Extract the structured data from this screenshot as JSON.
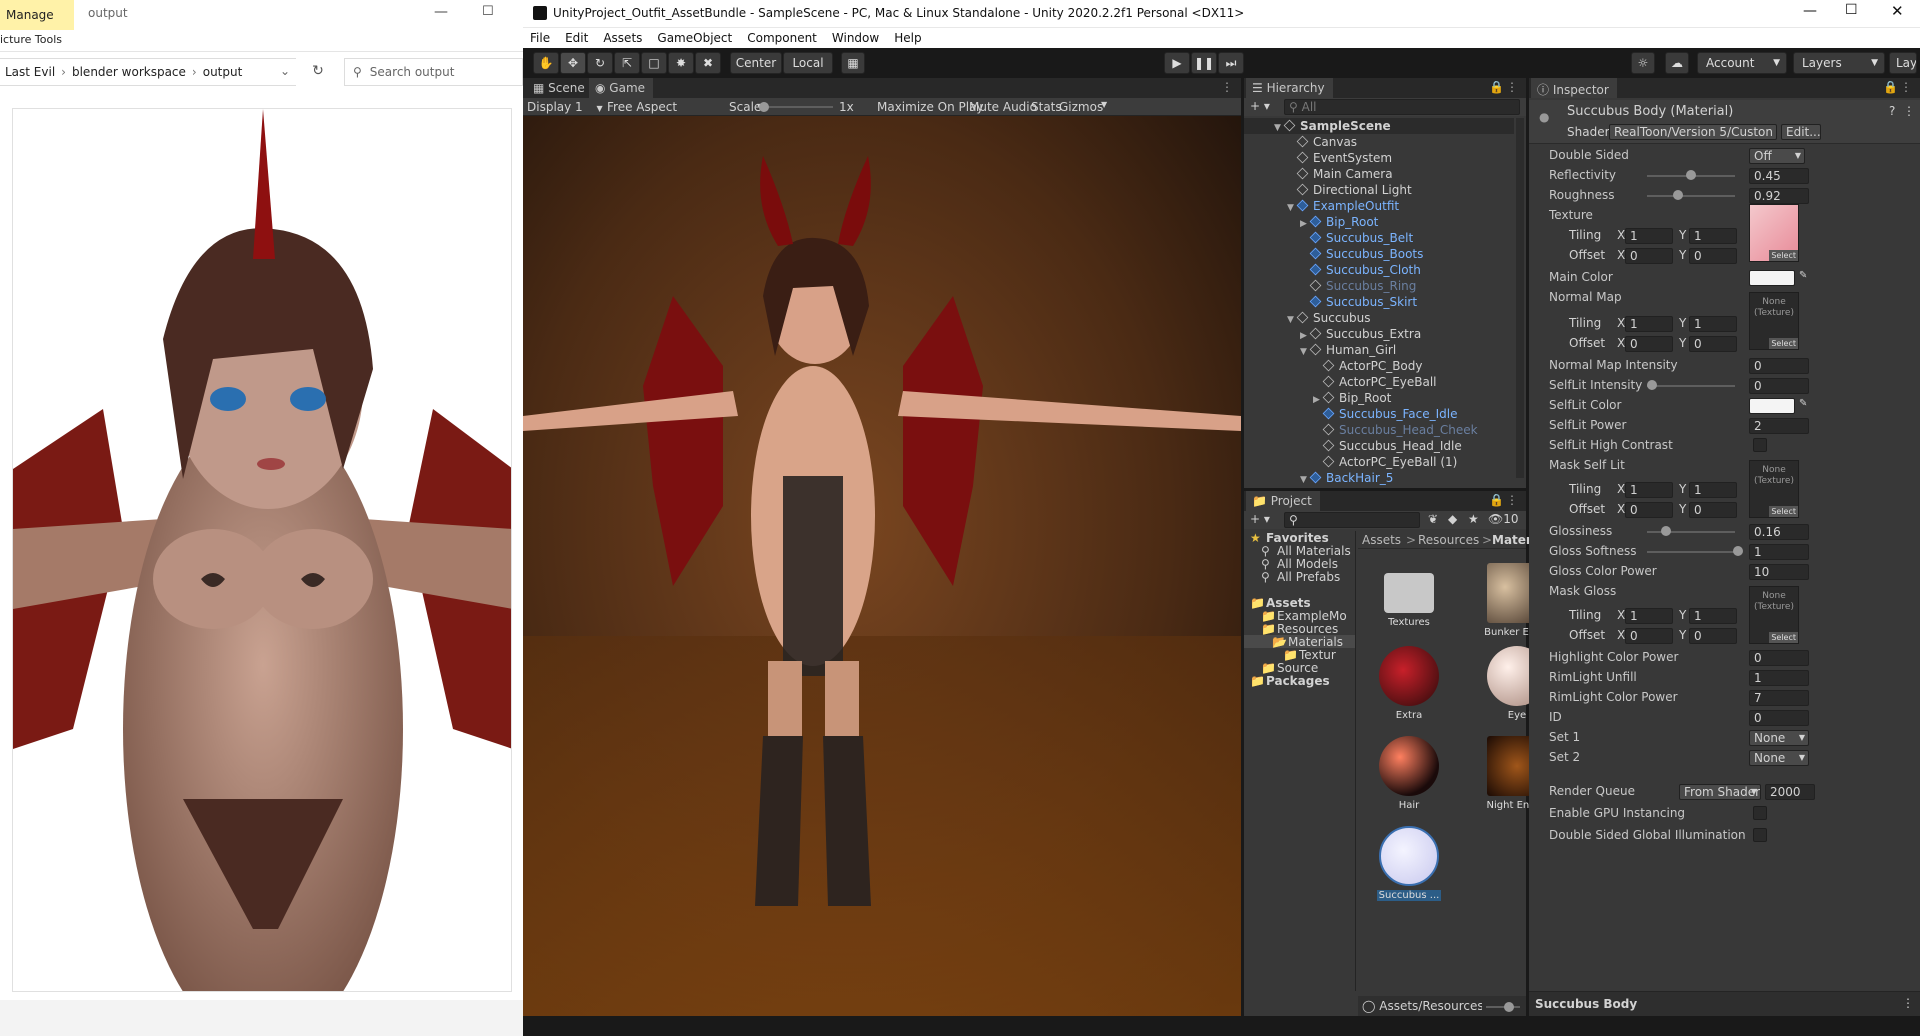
{
  "explorer": {
    "tab_manage": "Manage",
    "tab_output": "output",
    "picture_tools": "icture Tools",
    "breadcrumb": [
      "Last Evil",
      "blender workspace",
      "output"
    ],
    "search_placeholder": "Search output"
  },
  "unity": {
    "title": "UnityProject_Outfit_AssetBundle - SampleScene - PC, Mac & Linux Standalone - Unity 2020.2.2f1 Personal <DX11>",
    "menu": [
      "File",
      "Edit",
      "Assets",
      "GameObject",
      "Component",
      "Window",
      "Help"
    ],
    "toolbar": {
      "center": "Center",
      "local": "Local",
      "account": "Account",
      "layers": "Layers",
      "layout": "Layout"
    },
    "game": {
      "tab_scene": "Scene",
      "tab_game": "Game",
      "display": "Display 1",
      "aspect": "Free Aspect",
      "scale_label": "Scale",
      "scale_value": "1x",
      "maximize": "Maximize On Play",
      "mute": "Mute Audio",
      "stats": "Stats",
      "gizmos": "Gizmos"
    },
    "hierarchy": {
      "tab": "Hierarchy",
      "search": "All",
      "items": [
        {
          "label": "SampleScene",
          "blue": false,
          "dim": false
        },
        {
          "label": "Canvas",
          "blue": false,
          "dim": false
        },
        {
          "label": "EventSystem",
          "blue": false,
          "dim": false
        },
        {
          "label": "Main Camera",
          "blue": false,
          "dim": false
        },
        {
          "label": "Directional Light",
          "blue": false,
          "dim": false
        },
        {
          "label": "ExampleOutfit",
          "blue": true,
          "dim": false
        },
        {
          "label": "Bip_Root",
          "blue": true,
          "dim": false
        },
        {
          "label": "Succubus_Belt",
          "blue": true,
          "dim": false
        },
        {
          "label": "Succubus_Boots",
          "blue": true,
          "dim": false
        },
        {
          "label": "Succubus_Cloth",
          "blue": true,
          "dim": false
        },
        {
          "label": "Succubus_Ring",
          "blue": true,
          "dim": true
        },
        {
          "label": "Succubus_Skirt",
          "blue": true,
          "dim": false
        },
        {
          "label": "Succubus",
          "blue": false,
          "dim": false
        },
        {
          "label": "Succubus_Extra",
          "blue": false,
          "dim": false
        },
        {
          "label": "Human_Girl",
          "blue": false,
          "dim": false
        },
        {
          "label": "ActorPC_Body",
          "blue": false,
          "dim": false
        },
        {
          "label": "ActorPC_EyeBall",
          "blue": false,
          "dim": false
        },
        {
          "label": "Bip_Root",
          "blue": false,
          "dim": false
        },
        {
          "label": "Succubus_Face_Idle",
          "blue": true,
          "dim": false
        },
        {
          "label": "Succubus_Head_Cheek",
          "blue": true,
          "dim": true
        },
        {
          "label": "Succubus_Head_Idle",
          "blue": false,
          "dim": false
        },
        {
          "label": "ActorPC_EyeBall (1)",
          "blue": false,
          "dim": false
        },
        {
          "label": "BackHair_5",
          "blue": true,
          "dim": false
        }
      ]
    },
    "project": {
      "tab": "Project",
      "hidden_count": "10",
      "tree": [
        "Favorites",
        "All Materials",
        "All Models",
        "All Prefabs",
        "Assets",
        "ExampleMo",
        "Resources",
        "Materials",
        "Textur",
        "Source",
        "Packages"
      ],
      "breadcrumb": [
        "Assets",
        "Resources",
        "Materials"
      ],
      "assets": [
        "Textures",
        "Bunker Env...",
        "Extra",
        "Eye",
        "Hair",
        "Night Envi...",
        "Succubus ..."
      ],
      "footer_path": "Assets/Resources/Materia"
    },
    "inspector": {
      "tab": "Inspector",
      "material_name": "Succubus Body (Material)",
      "shader_label": "Shader",
      "shader_value": "RealToon/Version 5/Custon",
      "edit": "Edit...",
      "props": {
        "double_sided": "Double Sided",
        "double_sided_val": "Off",
        "reflectivity": "Reflectivity",
        "reflectivity_val": "0.45",
        "roughness": "Roughness",
        "roughness_val": "0.92",
        "texture": "Texture",
        "tiling": "Tiling",
        "offset": "Offset",
        "x": "X",
        "y": "Y",
        "one": "1",
        "zero": "0",
        "select": "Select",
        "none_texture": "None (Texture)",
        "main_color": "Main Color",
        "normal_map": "Normal Map",
        "normal_intensity": "Normal Map Intensity",
        "normal_intensity_val": "0",
        "selflit_intensity": "SelfLit Intensity",
        "selflit_intensity_val": "0",
        "selflit_color": "SelfLit Color",
        "selflit_power": "SelfLit Power",
        "selflit_power_val": "2",
        "selflit_hc": "SelfLit High Contrast",
        "mask_selflit": "Mask Self Lit",
        "glossiness": "Glossiness",
        "glossiness_val": "0.16",
        "gloss_softness": "Gloss Softness",
        "gloss_softness_val": "1",
        "gloss_color_power": "Gloss Color Power",
        "gloss_color_power_val": "10",
        "mask_gloss": "Mask Gloss",
        "highlight": "Highlight Color Power",
        "highlight_val": "0",
        "rimlight_unfill": "RimLight Unfill",
        "rimlight_unfill_val": "1",
        "rimlight_power": "RimLight Color Power",
        "rimlight_power_val": "7",
        "id": "ID",
        "id_val": "0",
        "set1": "Set 1",
        "set1_val": "None",
        "set2": "Set 2",
        "set2_val": "None",
        "render_queue": "Render Queue",
        "render_queue_src": "From Shader",
        "render_queue_val": "2000",
        "gpu_instancing": "Enable GPU Instancing",
        "dsgi": "Double Sided Global Illumination"
      },
      "footer": "Succubus Body"
    }
  }
}
